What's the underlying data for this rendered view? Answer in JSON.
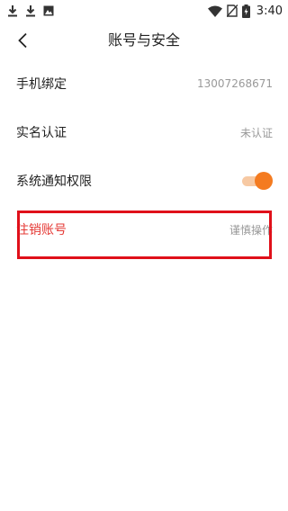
{
  "status_bar": {
    "time": "3:40",
    "left_icons": [
      "download-icon",
      "download-icon",
      "image-notification-icon"
    ],
    "right_icons": [
      "wifi-icon",
      "no-sim-icon",
      "battery-charging-icon"
    ]
  },
  "nav": {
    "back_icon": "chevron-left-icon",
    "title": "账号与安全"
  },
  "settings": {
    "phone_label": "手机绑定",
    "phone_value": "13007268671",
    "realname_label": "实名认证",
    "realname_value": "未认证",
    "notification_label": "系统通知权限",
    "notification_enabled": true,
    "cancel_label": "注销账号",
    "cancel_value": "谨慎操作"
  },
  "colors": {
    "accent": "#f47b20",
    "danger": "#e53935",
    "highlight": "#e0101a"
  }
}
